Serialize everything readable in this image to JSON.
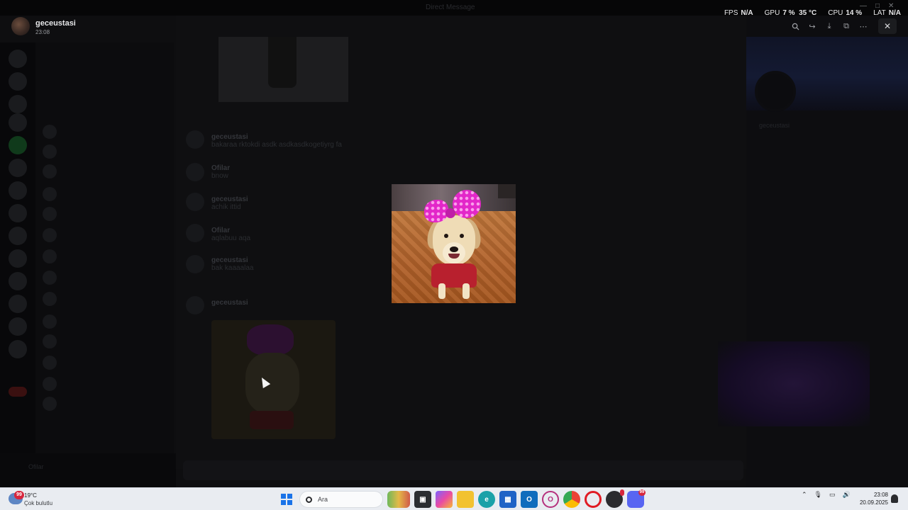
{
  "viewer": {
    "uploader_name": "geceustasi",
    "upload_time": "23:08",
    "toolbar_icons": [
      "zoom-icon",
      "forward-icon",
      "download-icon",
      "open-external-icon",
      "more-icon"
    ],
    "close_icon": "close-icon",
    "image_description_icon": "dog-photo"
  },
  "hud": {
    "fps_label": "FPS",
    "fps_value": "N/A",
    "gpu_label": "GPU",
    "gpu_value": "7 %",
    "gpu_temp": "35 °C",
    "cpu_label": "CPU",
    "cpu_value": "14 %",
    "lat_label": "LAT",
    "lat_value": "N/A"
  },
  "background": {
    "window_title": "Direct Message",
    "header_user": "geceustasi",
    "messages": [
      {
        "user": "geceustasi",
        "text": "bakaraa rktokdi asdk asdkasdkogetiyrg fa"
      },
      {
        "user": "Ofilar",
        "text": "bnow"
      },
      {
        "user": "geceustasi",
        "text": "achik ittid"
      },
      {
        "user": "Ofilar",
        "text": "aqlabuu aqa"
      },
      {
        "user": "geceustasi",
        "text": "bak kaaaalaa"
      },
      {
        "user": "geceustasi",
        "text": ""
      }
    ],
    "profile_name": "geceustasi",
    "user_bar_name": "Ofilar"
  },
  "taskbar": {
    "weather_temp": "19°C",
    "weather_desc": "Çok bulutlu",
    "weather_badge": "99",
    "search_placeholder": "Ara",
    "discord_badge": "99",
    "time": "23:08",
    "date": "20.09.2025",
    "accent": "#1a73e8"
  }
}
